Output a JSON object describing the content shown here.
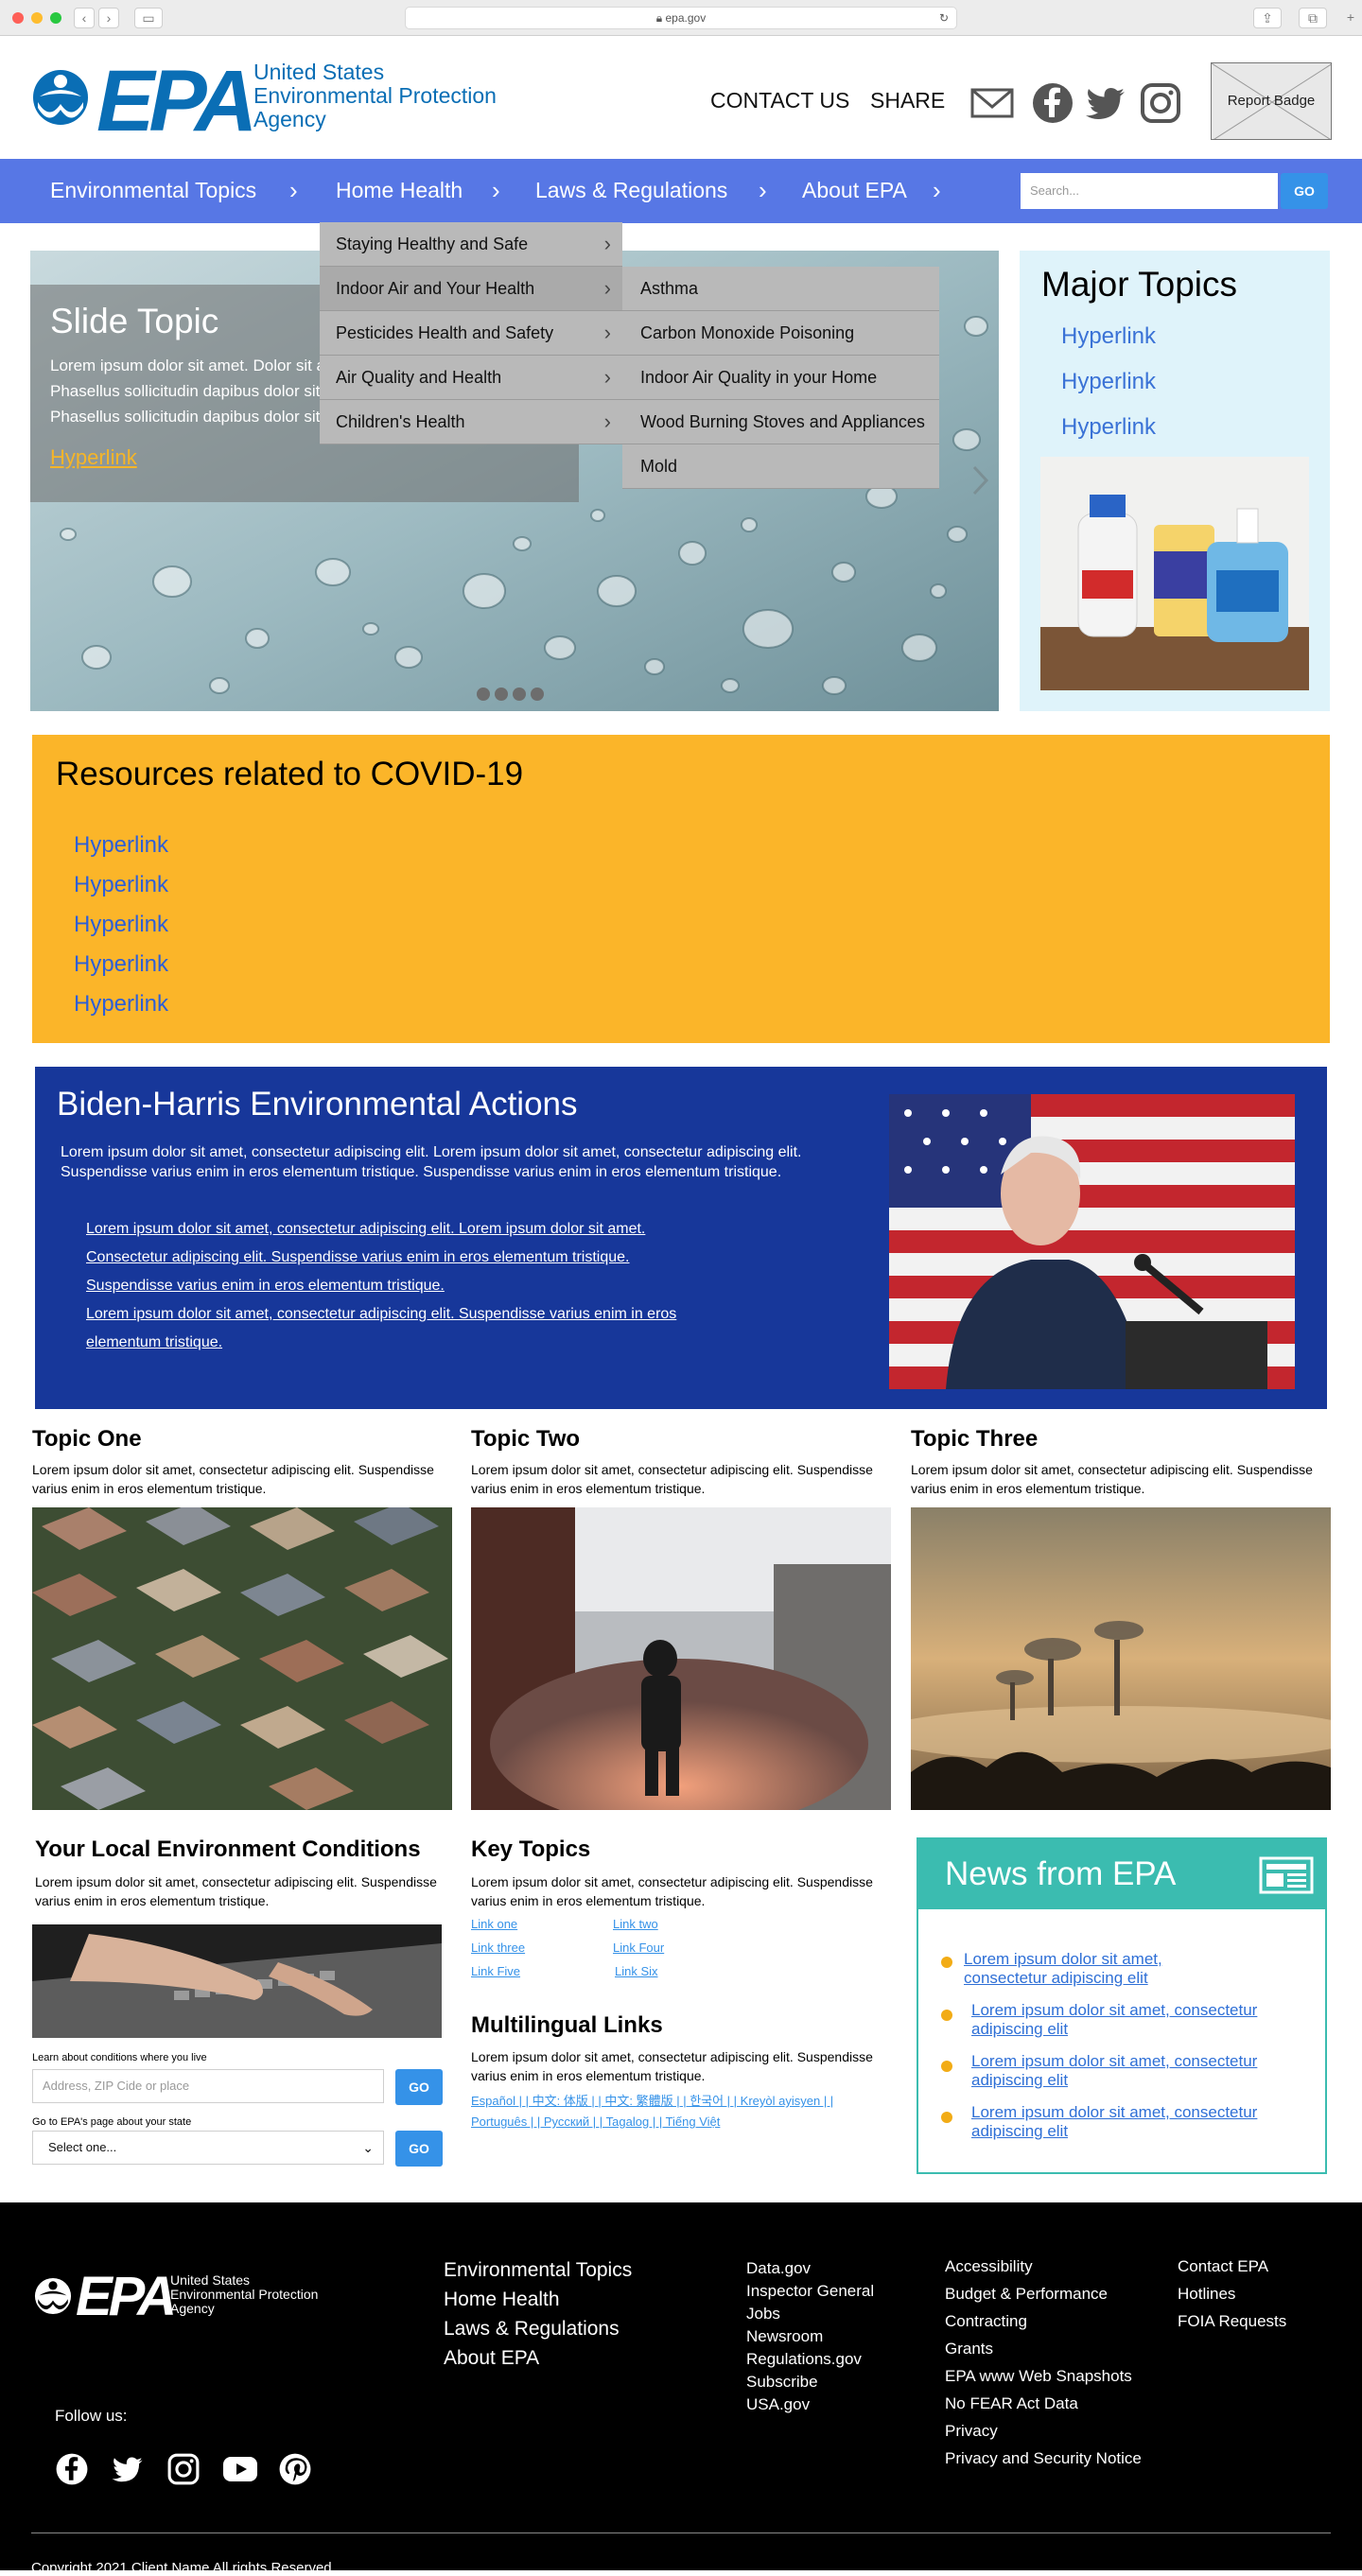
{
  "browser": {
    "url": "epa.gov"
  },
  "header": {
    "logo_text": "EPA",
    "agency_lines": [
      "United States",
      "Environmental Protection",
      "Agency"
    ],
    "contact": "CONTACT US",
    "share": "SHARE",
    "report_badge": "Report Badge"
  },
  "nav": {
    "items": [
      "Environmental Topics",
      "Home Health",
      "Laws & Regulations",
      "About EPA"
    ],
    "search_placeholder": "Search...",
    "go": "GO"
  },
  "dropdown": {
    "level1": [
      "Staying Healthy and Safe",
      "Indoor Air and Your Health",
      "Pesticides Health and Safety",
      "Air Quality and Health",
      "Children's Health"
    ],
    "level2": [
      "Asthma",
      "Carbon Monoxide Poisoning",
      "Indoor Air Quality in your Home",
      "Wood Burning Stoves and Appliances",
      "Mold"
    ]
  },
  "slide": {
    "title": "Slide Topic",
    "lines": [
      "Lorem ipsum dolor sit amet. Dolor sit amet, consectetur adipiscing elit.",
      "Phasellus sollicitudin dapibus dolor sit amet elementum tristique.",
      "Phasellus sollicitudin dapibus dolor sit amet elementum tristique."
    ],
    "link": "Hyperlink"
  },
  "major_topics": {
    "title": "Major Topics",
    "links": [
      "Hyperlink",
      "Hyperlink",
      "Hyperlink"
    ]
  },
  "covid": {
    "title": "Resources related to COVID-19",
    "links": [
      "Hyperlink",
      "Hyperlink",
      "Hyperlink",
      "Hyperlink",
      "Hyperlink"
    ]
  },
  "biden": {
    "title": "Biden-Harris Environmental Actions",
    "text": "Lorem ipsum dolor sit amet, consectetur adipiscing elit. Lorem ipsum dolor sit amet, consectetur adipiscing elit. Suspendisse varius enim in eros elementum tristique. Suspendisse varius enim in eros elementum tristique.",
    "links": [
      "Lorem ipsum dolor sit amet, consectetur adipiscing elit. Lorem ipsum dolor sit amet.",
      "Consectetur adipiscing elit. Suspendisse varius enim in eros elementum tristique. ",
      "Suspendisse varius enim in eros elementum tristique. ",
      "Lorem ipsum dolor sit amet, consectetur adipiscing elit. Suspendisse varius enim in eros",
      "elementum tristique."
    ]
  },
  "topics": [
    {
      "title": "Topic One",
      "text": "Lorem ipsum dolor sit amet, consectetur adipiscing elit. Suspendisse varius enim in eros elementum tristique."
    },
    {
      "title": "Topic Two",
      "text": "Lorem ipsum dolor sit amet, consectetur adipiscing elit. Suspendisse varius enim in eros elementum tristique."
    },
    {
      "title": "Topic Three",
      "text": "Lorem ipsum dolor sit amet, consectetur adipiscing elit. Suspendisse varius enim in eros elementum tristique."
    }
  ],
  "local": {
    "title": "Your Local Environment Conditions",
    "text": "Lorem ipsum dolor sit amet, consectetur adipiscing elit. Suspendisse varius enim in eros elementum tristique.",
    "learn_label": "Learn about conditions where you live",
    "address_placeholder": "Address, ZIP Cide or place",
    "go": "GO",
    "state_label": "Go to EPA's page about your state",
    "state_selected": "Select one..."
  },
  "key_topics": {
    "title": "Key Topics",
    "text": "Lorem ipsum dolor sit amet, consectetur adipiscing elit. Suspendisse varius enim in eros elementum tristique.",
    "links": [
      "Link one",
      "Link two",
      "Link three",
      "Link Four",
      "Link Five",
      "Link Six"
    ]
  },
  "multilingual": {
    "title": "Multilingual Links",
    "text": "Lorem ipsum dolor sit amet, consectetur adipiscing elit. Suspendisse varius enim in eros elementum tristique.",
    "line1": "Español | | 中文: 体版 | | 中文: 繁體版 | | 한국어 | | Kreyòl ayisyen | |",
    "line2": "Português | | Русский | | Tagalog | | Tiếng Việt"
  },
  "news": {
    "title": "News from EPA",
    "items": [
      [
        "Lorem ipsum dolor sit amet,",
        "consectetur adipiscing elit"
      ],
      [
        "Lorem ipsum dolor sit amet, consectetur",
        "adipiscing elit"
      ],
      [
        "Lorem ipsum dolor sit amet, consectetur",
        "adipiscing elit"
      ],
      [
        "Lorem ipsum dolor sit amet, consectetur",
        "adipiscing elit"
      ]
    ]
  },
  "footer": {
    "logo_text": "EPA",
    "agency_lines": [
      "United States",
      "Environmental Protection",
      "Agency"
    ],
    "nav": [
      "Environmental Topics",
      "Home Health",
      "Laws & Regulations",
      "About EPA"
    ],
    "col2": [
      "Data.gov",
      "Inspector General",
      "Jobs",
      "Newsroom",
      "Regulations.gov",
      "Subscribe",
      "USA.gov"
    ],
    "col3": [
      "Accessibility",
      "Budget & Performance",
      "Contracting",
      "Grants",
      "EPA www Web Snapshots",
      "No FEAR Act Data",
      "Privacy",
      "Privacy and Security Notice"
    ],
    "col4": [
      "Contact EPA",
      "Hotlines",
      "FOIA Requests"
    ],
    "follow": "Follow us:",
    "copyright": "Copyright 2021 Client Name All rights Reserved"
  },
  "colors": {
    "brand_blue": "#0a6eb5",
    "nav_blue": "#5777e5",
    "covid_yellow": "#fbb529",
    "biden_blue": "#17379a",
    "news_teal": "#3bbcb0",
    "link_blue": "#3592e8"
  }
}
